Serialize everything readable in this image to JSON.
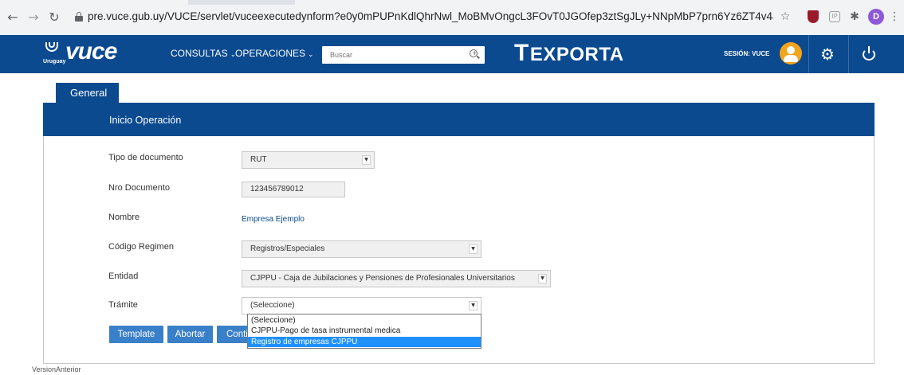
{
  "browser": {
    "url": "pre.vuce.gub.uy/VUCE/servlet/vuceexecutedynform?e0y0mPUPnKdlQhrNwl_MoBMvOngcL3FOvT0JGOfep3ztSgJLy+NNpMbP7prn6Yz6ZT4v4arHyEwVcOhhax5v5r_...",
    "profile_initial": "D",
    "icons": {
      "back": "back-arrow-icon",
      "forward": "forward-arrow-icon",
      "reload": "reload-icon",
      "lock": "lock-icon",
      "bookmark": "star-icon",
      "extensions": "puzzle-icon",
      "menu": "kebab-menu-icon"
    }
  },
  "header": {
    "logo_text": "vuce",
    "logo_sub": "Uruguay",
    "menu": [
      {
        "label": "CONSULTAS"
      },
      {
        "label": "OPERACIONES"
      }
    ],
    "search_placeholder": "Buscar",
    "brand_right": "EXPORTA",
    "brand_right_letter": "T",
    "session_label": "SESIÓN: VUCE",
    "colors": {
      "primary": "#0b4a8f",
      "avatar": "#f2a41b"
    }
  },
  "tabs": [
    {
      "label": "General",
      "active": true
    }
  ],
  "panel": {
    "title": "Inicio Operación",
    "fields": {
      "tipo_documento": {
        "label": "Tipo de documento",
        "value": "RUT"
      },
      "nro_documento": {
        "label": "Nro Documento",
        "value": "123456789012"
      },
      "nombre": {
        "label": "Nombre",
        "value": "Empresa Ejemplo"
      },
      "codigo_regimen": {
        "label": "Código Regimen",
        "value": "Registros/Especiales"
      },
      "entidad": {
        "label": "Entidad",
        "value": "CJPPU - Caja de Jubilaciones y Pensiones de Profesionales Universitarios"
      },
      "tramite": {
        "label": "Trámite",
        "value": "(Seleccione)",
        "options": [
          {
            "label": "(Seleccione)"
          },
          {
            "label": "CJPPU-Pago de tasa instrumental medica"
          },
          {
            "label": "Registro de empresas CJPPU",
            "highlighted": true
          }
        ]
      }
    },
    "buttons": {
      "template": "Template",
      "abortar": "Abortar",
      "continuar": "Continuar"
    }
  },
  "footer": {
    "link": "VersionAnterior"
  }
}
